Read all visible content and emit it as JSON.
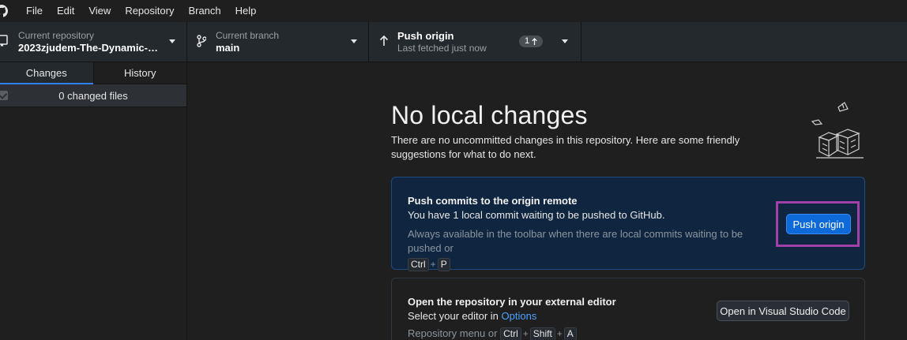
{
  "menu": {
    "items": [
      "File",
      "Edit",
      "View",
      "Repository",
      "Branch",
      "Help"
    ]
  },
  "toolbar": {
    "repo_label": "Current repository",
    "repo_value": "2023zjudem-The-Dynamic-Se...",
    "branch_label": "Current branch",
    "branch_value": "main",
    "push_title": "Push origin",
    "push_sub": "Last fetched just now",
    "push_count": "1"
  },
  "sidebar": {
    "tabs": [
      "Changes",
      "History"
    ],
    "changed_files": "0 changed files"
  },
  "main": {
    "title": "No local changes",
    "intro": "There are no uncommitted changes in this repository. Here are some friendly suggestions for what to do next.",
    "push_card": {
      "title": "Push commits to the origin remote",
      "text": "You have 1 local commit waiting to be pushed to GitHub.",
      "hint": "Always available in the toolbar when there are local commits waiting to be pushed or",
      "shortcut_keys": [
        "Ctrl",
        "P"
      ],
      "button": "Push origin"
    },
    "editor_card": {
      "title": "Open the repository in your external editor",
      "text_prefix": "Select your editor in",
      "text_link": "Options",
      "hint_prefix": "Repository menu or",
      "shortcut_keys": [
        "Ctrl",
        "Shift",
        "A"
      ],
      "button": "Open in Visual Studio Code"
    }
  },
  "colors": {
    "accent": "#0d6ad8",
    "highlight_frame": "#a040a8",
    "card_highlight_bg": "#102640"
  }
}
